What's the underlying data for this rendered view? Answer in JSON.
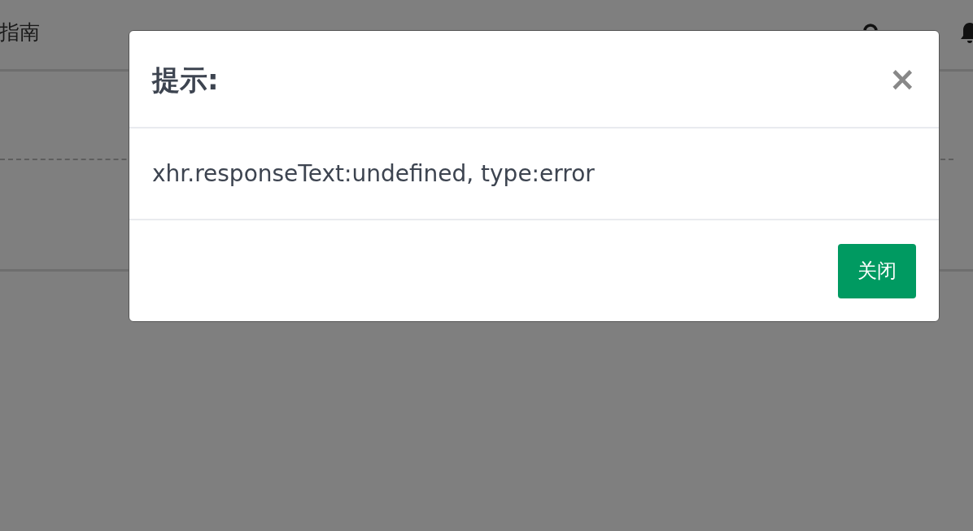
{
  "page": {
    "nav_link": "指南"
  },
  "dialog": {
    "title": "提示:",
    "close_symbol": "×",
    "message": "xhr.responseText:undefined, type:error",
    "buttons": [
      "关闭"
    ]
  }
}
